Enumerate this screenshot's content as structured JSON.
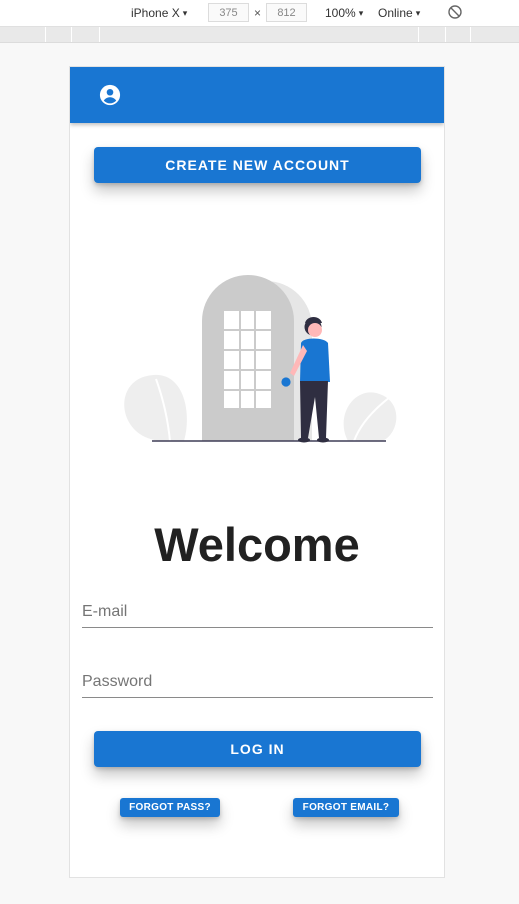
{
  "devtools": {
    "device": "iPhone X",
    "width": "375",
    "height": "812",
    "times_sign": "×",
    "zoom": "100%",
    "network": "Online",
    "caret": "▾",
    "rotate_icon": "rotate-icon"
  },
  "app": {
    "colors": {
      "primary": "#1976d2",
      "text": "#212121",
      "placeholder": "#757575"
    },
    "app_bar": {
      "icon": "account-circle-icon"
    },
    "create_account_label": "CREATE NEW ACCOUNT",
    "welcome_title": "Welcome",
    "email": {
      "placeholder": "E-mail",
      "value": ""
    },
    "password": {
      "placeholder": "Password",
      "value": ""
    },
    "login_label": "LOG IN",
    "forgot_pass_label": "FORGOT PASS?",
    "forgot_email_label": "FORGOT EMAIL?"
  }
}
